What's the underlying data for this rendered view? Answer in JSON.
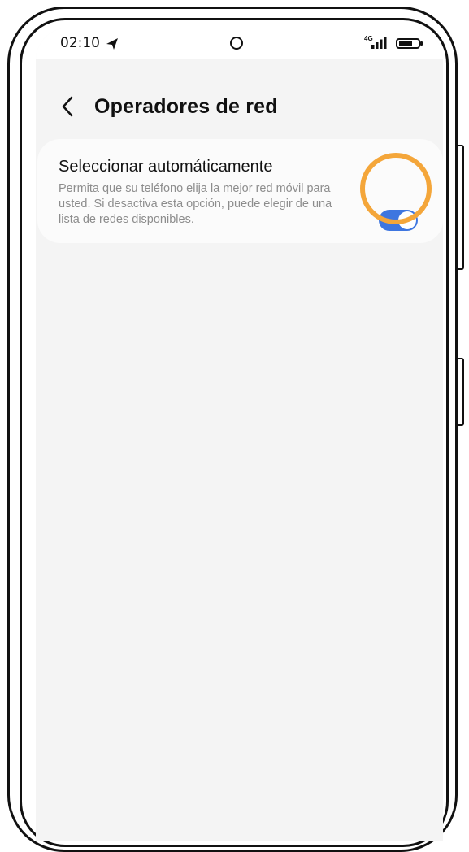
{
  "status_bar": {
    "time": "02:10",
    "network": "4G",
    "icons": [
      "location-arrow-icon",
      "camera-cutout",
      "signal-icon",
      "battery-icon"
    ]
  },
  "header": {
    "back_icon": "chevron-left-icon",
    "title": "Operadores de red"
  },
  "setting": {
    "title": "Seleccionar automáticamente",
    "description": "Permita que su teléfono elija la mejor red móvil para usted. Si desactiva esta opción, puede elegir de una lista de redes disponibles.",
    "toggle_on": true
  },
  "colors": {
    "toggle_on": "#3e76e0",
    "highlight": "#f4a63a",
    "screen_bg": "#f4f4f4"
  }
}
